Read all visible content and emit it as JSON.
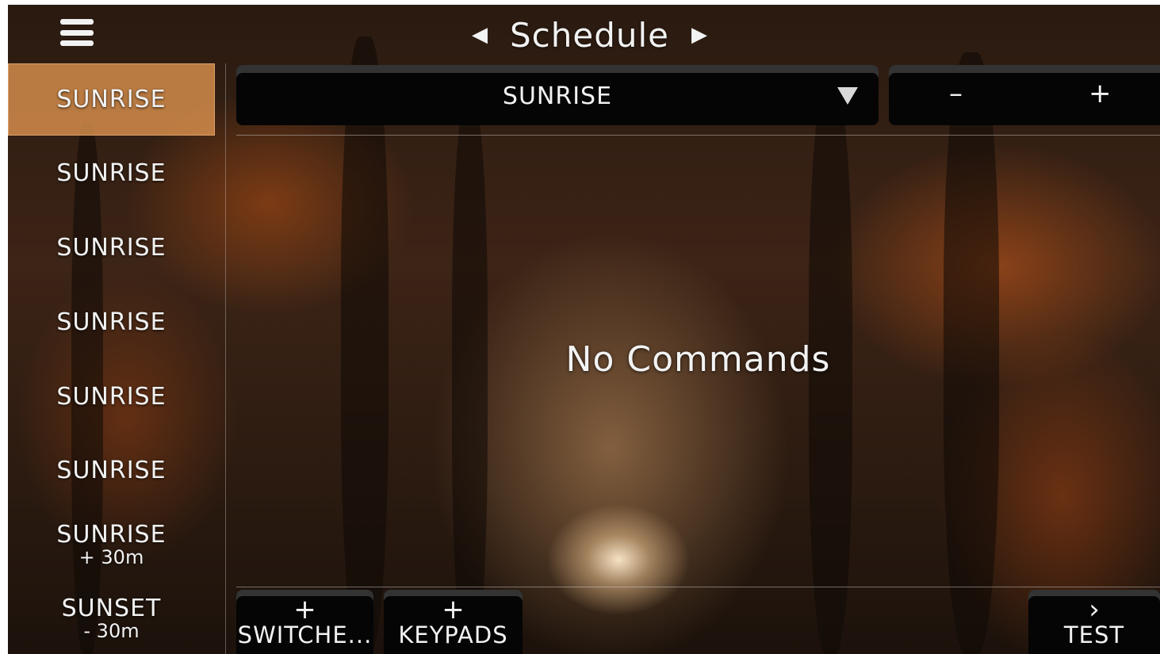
{
  "header": {
    "menu_icon": "hamburger-menu-icon",
    "prev_icon": "◀",
    "next_icon": "▶",
    "title": "Schedule"
  },
  "sidebar": {
    "items": [
      {
        "main": "SUNRISE",
        "sub": "",
        "selected": true
      },
      {
        "main": "SUNRISE",
        "sub": ""
      },
      {
        "main": "SUNRISE",
        "sub": ""
      },
      {
        "main": "SUNRISE",
        "sub": ""
      },
      {
        "main": "SUNRISE",
        "sub": ""
      },
      {
        "main": "SUNRISE",
        "sub": ""
      },
      {
        "main": "SUNRISE",
        "sub": "+ 30m"
      },
      {
        "main": "SUNSET",
        "sub": "- 30m"
      }
    ]
  },
  "event_selector": {
    "value": "SUNRISE",
    "caret_icon": "caret-down-icon"
  },
  "offset_stepper": {
    "minus_label": "–",
    "plus_label": "+"
  },
  "content": {
    "empty_message": "No Commands"
  },
  "footer": {
    "add_switches": {
      "glyph": "+",
      "label": "SWITCHE..."
    },
    "add_keypads": {
      "glyph": "+",
      "label": "KEYPADS"
    },
    "test": {
      "glyph": "›",
      "label": "TEST"
    }
  },
  "colors": {
    "selected_item_bg": "#e29650",
    "panel_bg": "#050505",
    "text": "#f2f2f2"
  }
}
